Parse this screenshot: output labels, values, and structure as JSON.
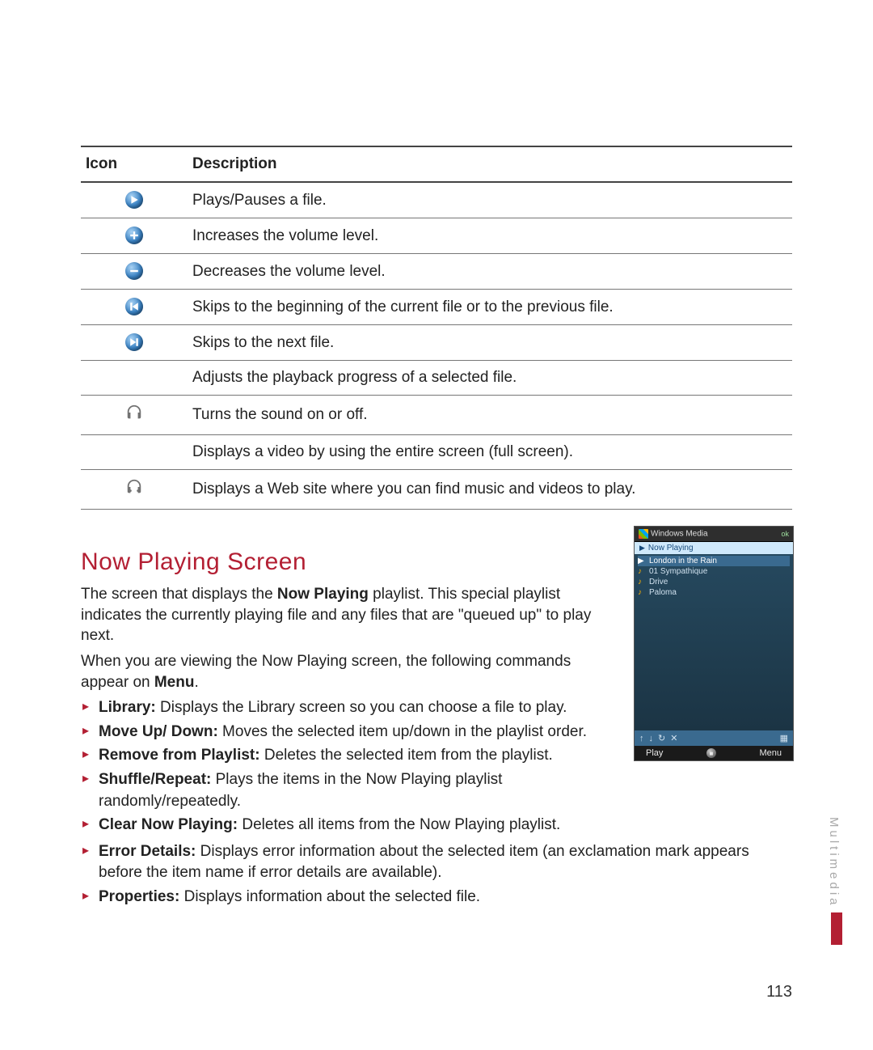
{
  "table": {
    "headers": {
      "icon": "Icon",
      "desc": "Description"
    },
    "rows": [
      {
        "icon_name": "play-pause-icon",
        "desc": "Plays/Pauses a file."
      },
      {
        "icon_name": "volume-up-icon",
        "desc": "Increases the volume level."
      },
      {
        "icon_name": "volume-down-icon",
        "desc": "Decreases the volume level."
      },
      {
        "icon_name": "skip-prev-icon",
        "desc": "Skips to the beginning of the current file or to the previous file."
      },
      {
        "icon_name": "skip-next-icon",
        "desc": "Skips to the next file."
      },
      {
        "icon_name": "progress-icon",
        "desc": "Adjusts the playback progress of a selected file."
      },
      {
        "icon_name": "headphones-icon",
        "desc": "Turns the sound on or off."
      },
      {
        "icon_name": "fullscreen-icon",
        "desc": "Displays a video by using the entire screen (full screen)."
      },
      {
        "icon_name": "web-headphones-icon",
        "desc": "Displays a Web site where you can find music and videos to play."
      }
    ]
  },
  "section": {
    "title": "Now Playing Screen",
    "p1a": "The screen that displays the ",
    "p1b": "Now Playing",
    "p1c": " playlist. This special playlist indicates the currently playing file and any files that are \"queued up\" to play next.",
    "p2a": "When you are viewing the Now Playing screen, the following commands appear on ",
    "p2b": "Menu",
    "p2c": "."
  },
  "commands_narrow": [
    {
      "label": "Library:",
      "text": " Displays the Library screen so you can choose a file to play."
    },
    {
      "label": "Move Up/ Down:",
      "text": " Moves the selected item up/down in the playlist order."
    },
    {
      "label": "Remove from Playlist:",
      "text": " Deletes the selected item from the playlist."
    },
    {
      "label": "Shuffle/Repeat:",
      "text": " Plays the items in the Now Playing playlist randomly/repeatedly."
    },
    {
      "label": "Clear Now Playing:",
      "text": " Deletes all items from the Now Playing playlist."
    }
  ],
  "commands_wide": [
    {
      "label": "Error Details:",
      "text": " Displays error information about the selected item (an exclamation mark appears before the item name if error details are available)."
    },
    {
      "label": "Properties:",
      "text": " Displays information about the selected file."
    }
  ],
  "screenshot": {
    "title": "Windows Media",
    "status_icons": "ok",
    "subtitle": "Now Playing",
    "tracks": [
      {
        "name": "London in the Rain",
        "current": true
      },
      {
        "name": "01 Sympathique",
        "current": false
      },
      {
        "name": "Drive",
        "current": false
      },
      {
        "name": "Paloma",
        "current": false
      }
    ],
    "ctrl_icons": [
      "↑",
      "↓",
      "↻",
      "✕",
      "▦"
    ],
    "menu": {
      "left": "Play",
      "right": "Menu"
    }
  },
  "side_label": "Multimedia",
  "page_number": "113"
}
